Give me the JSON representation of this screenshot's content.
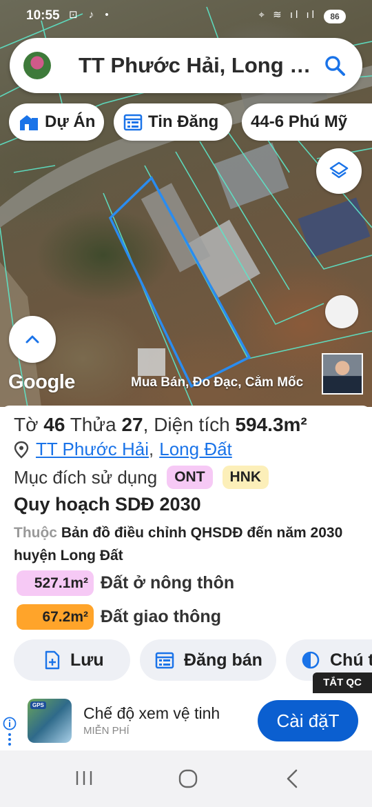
{
  "status_bar": {
    "time": "10:55",
    "battery": "86"
  },
  "search": {
    "text": "TT Phước Hải, Long …"
  },
  "chips": {
    "du_an": "Dự Án",
    "tin_dang": "Tin Đăng",
    "address": "44-6 Phú Mỹ"
  },
  "map": {
    "google_label": "Google",
    "caption": "Mua Bán, Đo Đạc, Cắm Mốc"
  },
  "parcel": {
    "sheet_label": "Tờ",
    "sheet_no": "46",
    "lot_label": "Thửa",
    "lot_no": "27",
    "area_label": "Diện tích",
    "area": "594.3m²",
    "location_town": "TT Phước Hải",
    "location_district": "Long Đất",
    "purpose_label": "Mục đích sử dụng",
    "purpose_tags": [
      "ONT",
      "HNK"
    ]
  },
  "planning": {
    "title": "Quy hoạch SDĐ 2030",
    "belongs_prefix": "Thuộc",
    "belongs_text": "Bản đồ điều chỉnh QHSDĐ đến năm 2030 huyện Long Đất",
    "areas": [
      {
        "value": "527.1m²",
        "label": "Đất ở nông thôn",
        "color": "#f6c9f5"
      },
      {
        "value": "67.2m²",
        "label": "Đất giao thông",
        "color": "#ffa42a"
      }
    ]
  },
  "actions": {
    "save": "Lưu",
    "post": "Đăng bán",
    "legend": "Chú thích"
  },
  "ad": {
    "close_label": "TẮT QC",
    "icon_badge": "GPS",
    "title": "Chế độ xem vệ tinh",
    "subtitle": "MIỄN PHÍ",
    "install": "Cài đặT"
  }
}
